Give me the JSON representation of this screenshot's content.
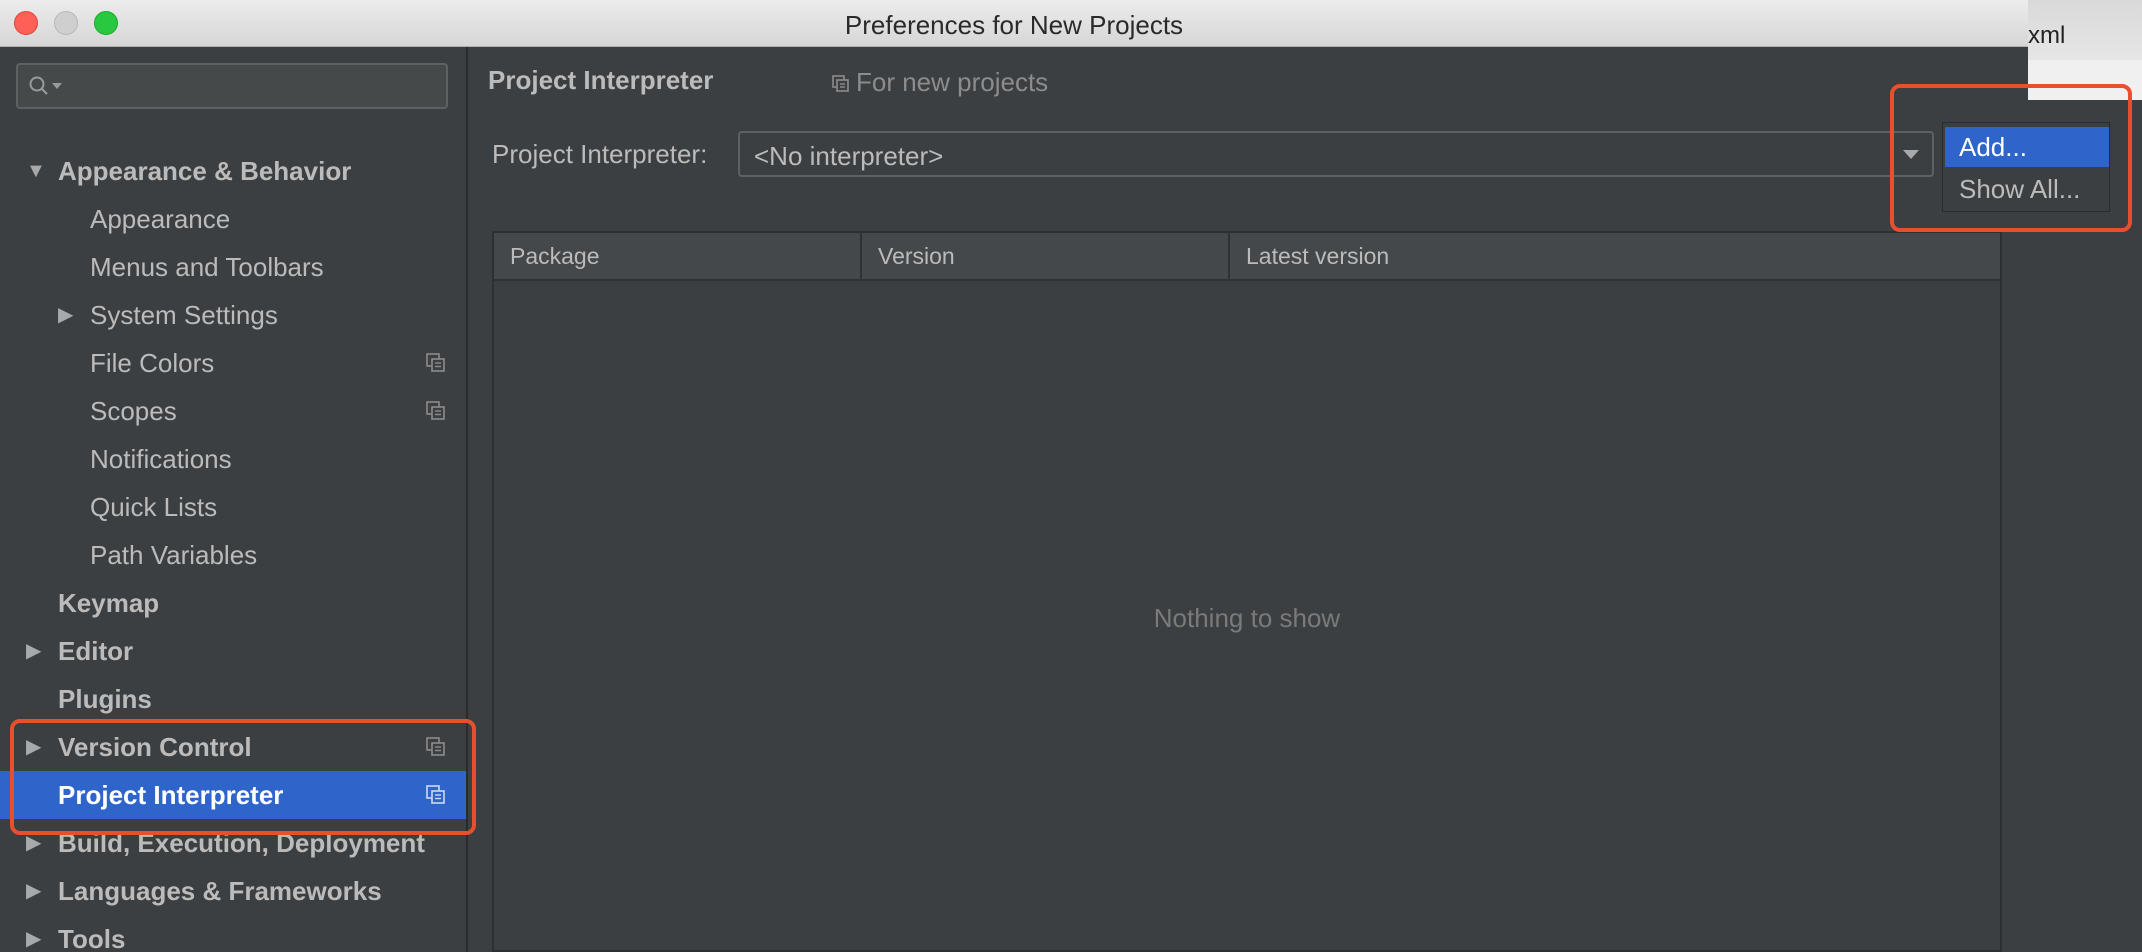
{
  "window": {
    "title": "Preferences for New Projects"
  },
  "background_app": {
    "tab_fragment": "xml"
  },
  "search": {
    "placeholder": ""
  },
  "sidebar": {
    "items": [
      {
        "label": "Appearance & Behavior",
        "bold": true,
        "expanded": true,
        "indent": 0
      },
      {
        "label": "Appearance",
        "indent": 1
      },
      {
        "label": "Menus and Toolbars",
        "indent": 1
      },
      {
        "label": "System Settings",
        "indent": 1,
        "collapsed": true
      },
      {
        "label": "File Colors",
        "indent": 1,
        "copy_icon": true
      },
      {
        "label": "Scopes",
        "indent": 1,
        "copy_icon": true
      },
      {
        "label": "Notifications",
        "indent": 1
      },
      {
        "label": "Quick Lists",
        "indent": 1
      },
      {
        "label": "Path Variables",
        "indent": 1
      },
      {
        "label": "Keymap",
        "bold": true,
        "indent": 0
      },
      {
        "label": "Editor",
        "bold": true,
        "indent": 0,
        "collapsed": true
      },
      {
        "label": "Plugins",
        "bold": true,
        "indent": 0
      },
      {
        "label": "Version Control",
        "bold": true,
        "indent": 0,
        "collapsed": true,
        "copy_icon": true
      },
      {
        "label": "Project Interpreter",
        "bold": true,
        "indent": 0,
        "selected": true,
        "copy_icon": true
      },
      {
        "label": "Build, Execution, Deployment",
        "bold": true,
        "indent": 0,
        "collapsed": true
      },
      {
        "label": "Languages & Frameworks",
        "bold": true,
        "indent": 0,
        "collapsed": true
      },
      {
        "label": "Tools",
        "bold": true,
        "indent": 0,
        "collapsed": true
      }
    ]
  },
  "main": {
    "title": "Project Interpreter",
    "scope_note": "For new projects",
    "interpreter_label": "Project Interpreter:",
    "interpreter_value": "<No interpreter>",
    "table": {
      "columns": [
        "Package",
        "Version",
        "Latest version"
      ],
      "empty_text": "Nothing to show"
    }
  },
  "popup": {
    "items": [
      {
        "label": "Add...",
        "selected": true
      },
      {
        "label": "Show All...",
        "selected": false
      }
    ]
  },
  "colors": {
    "selection": "#2f65ca",
    "annotation": "#e8502d",
    "panel": "#3c3f41"
  }
}
